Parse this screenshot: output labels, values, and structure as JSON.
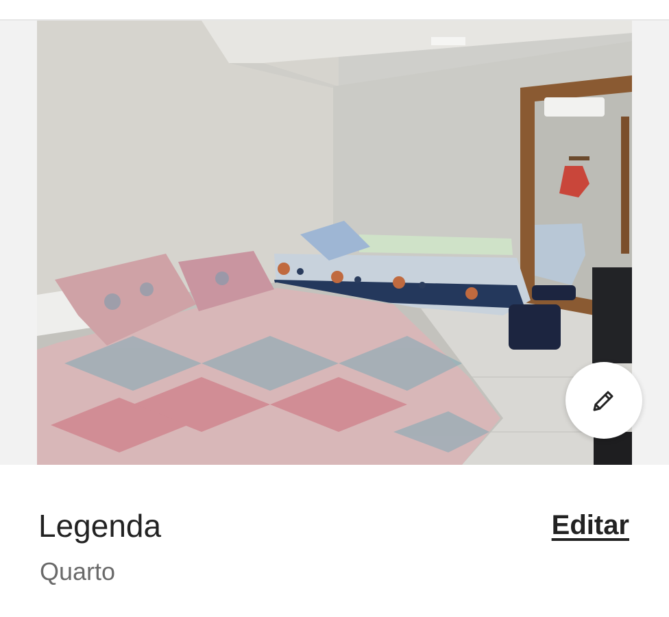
{
  "photo": {
    "subject": "bedroom-photo"
  },
  "edit_fab": {
    "icon": "pencil-icon"
  },
  "caption": {
    "title": "Legenda",
    "value": "Quarto",
    "edit_label": "Editar"
  },
  "colors": {
    "text_primary": "#222222",
    "text_secondary": "#6a6a6a",
    "background": "#ffffff",
    "photo_band": "#f2f2f2"
  }
}
